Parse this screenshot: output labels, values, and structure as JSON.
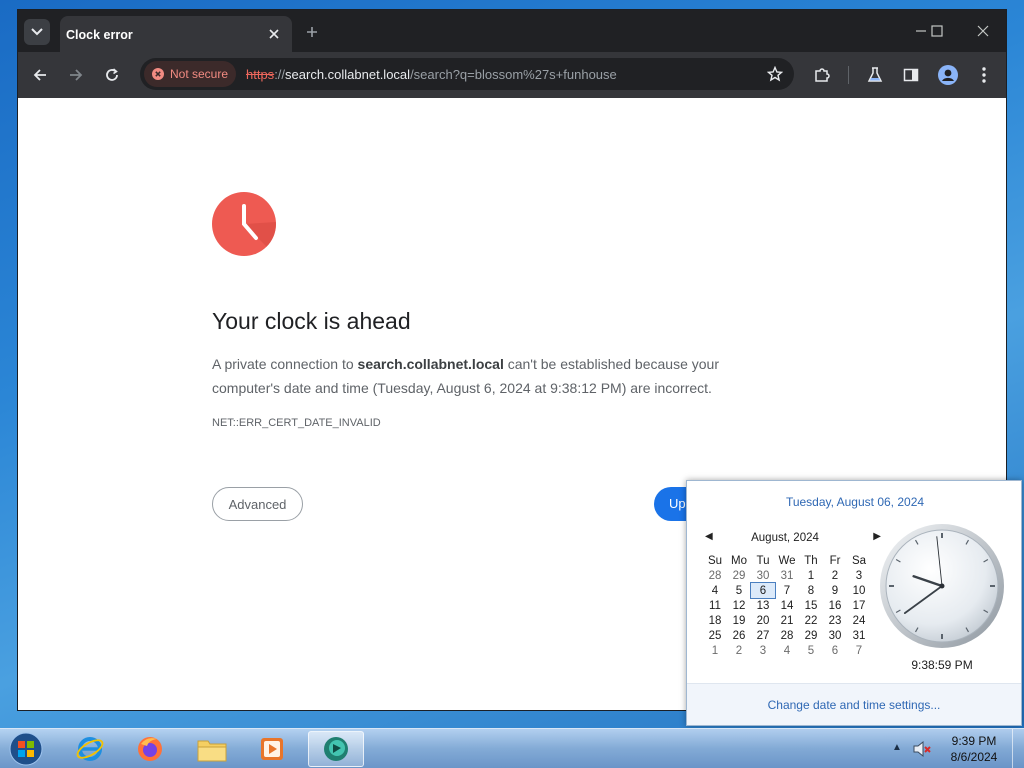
{
  "browser": {
    "tab_title": "Clock error",
    "security_chip": "Not secure",
    "url": {
      "scheme": "https",
      "sep": "://",
      "host": "search.collabnet.local",
      "path": "/search?q=blossom%27s+funhouse"
    }
  },
  "interstitial": {
    "heading": "Your clock is ahead",
    "desc_pre": "A private connection to ",
    "desc_host": "search.collabnet.local",
    "desc_post": " can't be established because your computer's date and time (Tuesday, August 6, 2024 at 9:38:12 PM) are incorrect.",
    "error_code": "NET::ERR_CERT_DATE_INVALID",
    "advanced_label": "Advanced",
    "update_label": "Up"
  },
  "flyout": {
    "long_date": "Tuesday, August 06, 2024",
    "month_label": "August, 2024",
    "weekdays": [
      "Su",
      "Mo",
      "Tu",
      "We",
      "Th",
      "Fr",
      "Sa"
    ],
    "weeks": [
      [
        "28",
        "29",
        "30",
        "31",
        "1",
        "2",
        "3"
      ],
      [
        "4",
        "5",
        "6",
        "7",
        "8",
        "9",
        "10"
      ],
      [
        "11",
        "12",
        "13",
        "14",
        "15",
        "16",
        "17"
      ],
      [
        "18",
        "19",
        "20",
        "21",
        "22",
        "23",
        "24"
      ],
      [
        "25",
        "26",
        "27",
        "28",
        "29",
        "30",
        "31"
      ],
      [
        "1",
        "2",
        "3",
        "4",
        "5",
        "6",
        "7"
      ]
    ],
    "today": "6",
    "time_text": "9:38:59 PM",
    "clock": {
      "hours": 9,
      "minutes": 38,
      "seconds": 59
    },
    "change_link": "Change date and time settings..."
  },
  "taskbar": {
    "time": "9:39 PM",
    "date": "8/6/2024",
    "apps": [
      "internet-explorer",
      "firefox",
      "file-explorer",
      "media-player",
      "active-app"
    ]
  },
  "colors": {
    "accent": "#1a73e8",
    "danger": "#ee5a52",
    "link": "#2f68b4"
  }
}
